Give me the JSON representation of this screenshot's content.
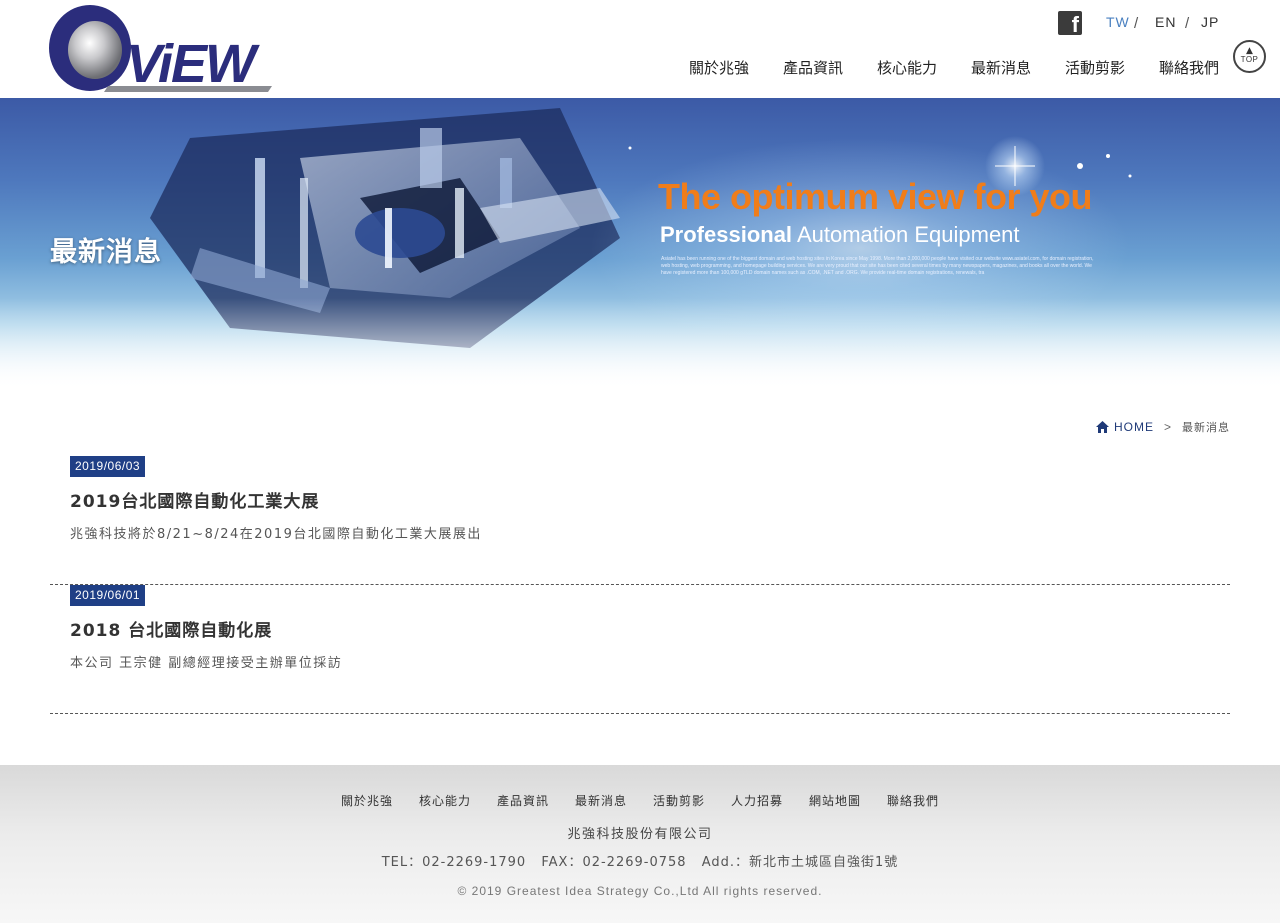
{
  "header": {
    "logo_text": "ViEW",
    "social": {
      "icon": "facebook-icon",
      "glyph": "f"
    },
    "languages": [
      {
        "label": "TW",
        "color": "#4a80c0"
      },
      {
        "label": "EN",
        "color": "#333333"
      },
      {
        "label": "JP",
        "color": "#333333"
      }
    ],
    "lang_separator": "/",
    "nav": [
      "關於兆強",
      "產品資訊",
      "核心能力",
      "最新消息",
      "活動剪影",
      "聯絡我們"
    ],
    "top_button": {
      "arrow": "▲",
      "label": "TOP"
    }
  },
  "banner": {
    "page_title": "最新消息",
    "tagline": "The optimum view for you",
    "subtagline_bold": "Professional",
    "subtagline_rest": "Automation Equipment",
    "small_text": "Asiatel has been running one of the biggest domain and web hosting sites in Korea since May 1998. More than 2,000,000 people have visited our website www.asiatel.com, for domain registration, web hosting, web programming, and homepage building services. We are very proud that our site has been cited several times by many newspapers, magazines, and books all over the world. We have registered more than 100,000 gTLD domain names such as .COM, .NET and .ORG. We provide real-time domain registrations, renewals, tra"
  },
  "breadcrumb": {
    "home": "HOME",
    "separator": ">",
    "current": "最新消息"
  },
  "news": [
    {
      "date": "2019/06/03",
      "title": "2019台北國際自動化工業大展",
      "desc": "兆強科技將於8/21~8/24在2019台北國際自動化工業大展展出"
    },
    {
      "date": "2019/06/01",
      "title": "2018 台北國際自動化展",
      "desc": "本公司 王宗健 副總經理接受主辦單位採訪"
    }
  ],
  "footer": {
    "nav": [
      "關於兆強",
      "核心能力",
      "產品資訊",
      "最新消息",
      "活動剪影",
      "人力招募",
      "網站地圖",
      "聯絡我們"
    ],
    "company": "兆強科技股份有限公司",
    "tel": "TEL：02-2269-1790",
    "fax": "FAX：02-2269-0758",
    "address": "Add.：新北市土城區自強街1號",
    "copyright": "© 2019 Greatest Idea Strategy Co.,Ltd All rights reserved."
  },
  "colors": {
    "brand_navy": "#2b2d7c",
    "date_badge": "#1f3f86",
    "tagline_orange": "#f07d1a",
    "active_lang": "#4a80c0"
  }
}
